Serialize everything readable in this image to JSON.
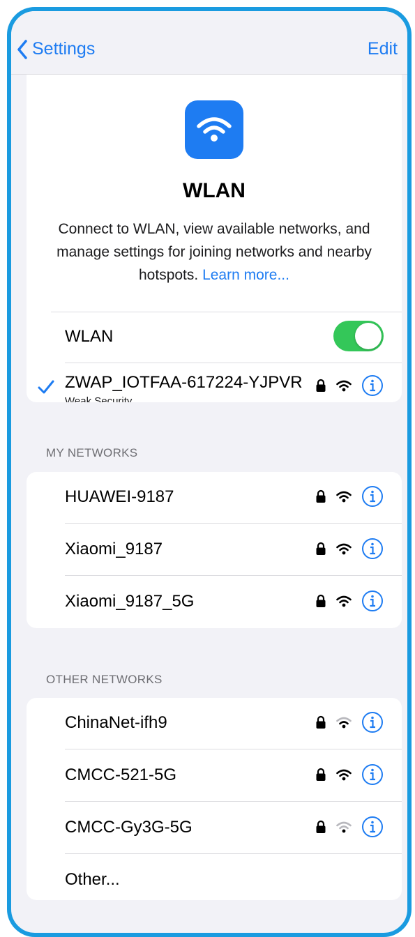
{
  "nav": {
    "back_label": "Settings",
    "edit_label": "Edit"
  },
  "hero": {
    "title": "WLAN",
    "description": "Connect to WLAN, view available networks, and manage settings for joining networks and nearby hotspots.",
    "link": "Learn more..."
  },
  "wlan_toggle": {
    "label": "WLAN",
    "state": "on"
  },
  "connected": {
    "ssid": "ZWAP_IOTFAA-617224-YJPVR",
    "note": "Weak Security",
    "signal": "full"
  },
  "my_networks": {
    "title": "MY NETWORKS",
    "items": [
      {
        "ssid": "HUAWEI-9187",
        "signal": "full"
      },
      {
        "ssid": "Xiaomi_9187",
        "signal": "full"
      },
      {
        "ssid": "Xiaomi_9187_5G",
        "signal": "full"
      }
    ]
  },
  "other_networks": {
    "title": "OTHER NETWORKS",
    "items": [
      {
        "ssid": "ChinaNet-ifh9",
        "signal": "weak"
      },
      {
        "ssid": "CMCC-521-5G",
        "signal": "full"
      },
      {
        "ssid": "CMCC-Gy3G-5G",
        "signal": "weak"
      }
    ],
    "other_label": "Other..."
  },
  "colors": {
    "accent": "#1e7cf2",
    "toggle_on": "#34c759",
    "frame": "#1a9be0",
    "background": "#f2f2f7"
  },
  "icons": {
    "back": "chevron-left-icon",
    "app": "wifi-icon",
    "lock": "lock-icon",
    "signal": "wifi-signal-icon",
    "info": "info-icon",
    "check": "checkmark-icon"
  }
}
